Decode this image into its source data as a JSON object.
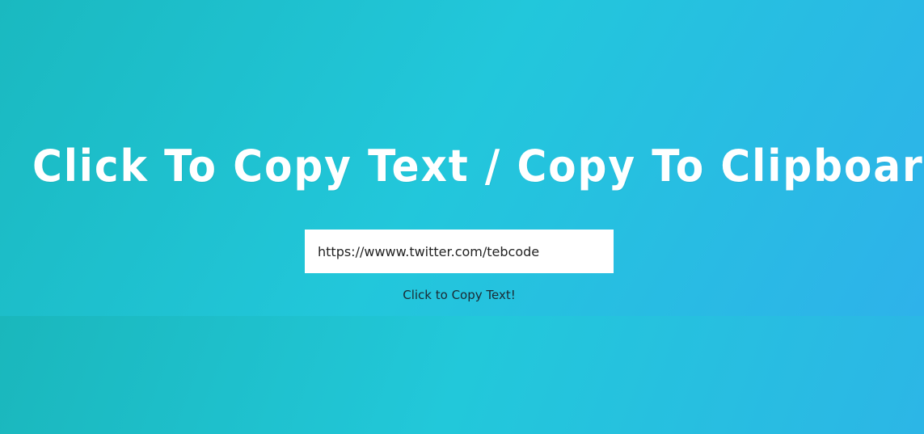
{
  "page": {
    "title": "Click To Copy Text / Copy To Clipboard"
  },
  "copy_field": {
    "value": "https://wwww.twitter.com/tebcode"
  },
  "copy_button": {
    "label": "Click to Copy Text!"
  },
  "colors": {
    "background_start": "#1ab8bf",
    "background_mid": "#22c6da",
    "background_end": "#2fb0ea",
    "title_text": "#ffffff",
    "input_background": "#ffffff",
    "button_text": "#1b2a33"
  }
}
